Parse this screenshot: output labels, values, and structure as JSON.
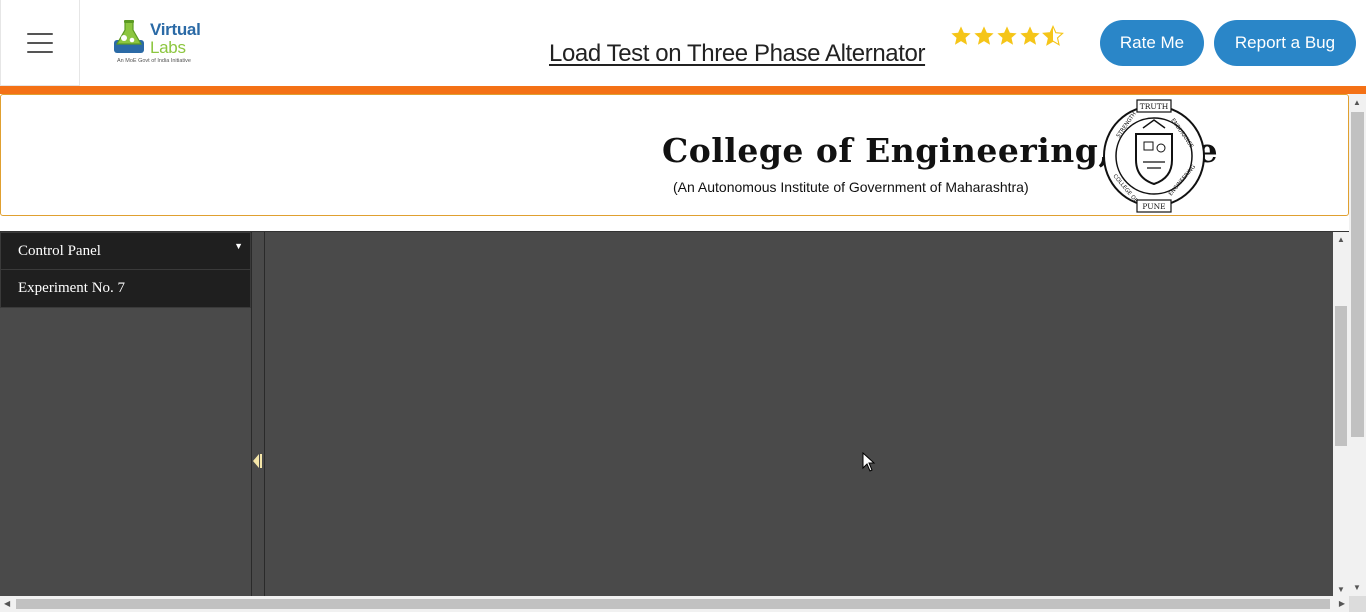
{
  "header": {
    "menu_icon": "hamburger-menu-icon",
    "logo": {
      "line1": "Virtual",
      "line2": "Labs",
      "tagline": "An MoE Govt of India Initiative"
    },
    "title": "Load Test on Three Phase Alternator",
    "rating": {
      "value": 4.5,
      "max": 5,
      "color": "#f5c518"
    },
    "rate_button": "Rate Me",
    "bug_button": "Report a Bug",
    "accent_color": "#f47116",
    "button_color": "#2a86c8"
  },
  "banner": {
    "college_name": "College of Engineering, Pune",
    "subtitle": "(An Autonomous Institute of Government of Maharashtra)",
    "emblem": {
      "top": "TRUTH",
      "left": "STRENGTH",
      "right": "ENDURANCE",
      "bottom_left": "COLLEGE OF",
      "bottom_right": "ENGINEERING",
      "bottom": "PUNE"
    }
  },
  "sidebar": {
    "items": [
      {
        "label": "Control Panel",
        "icon": "caret-down-icon"
      },
      {
        "label": "Experiment No. 7"
      }
    ]
  }
}
